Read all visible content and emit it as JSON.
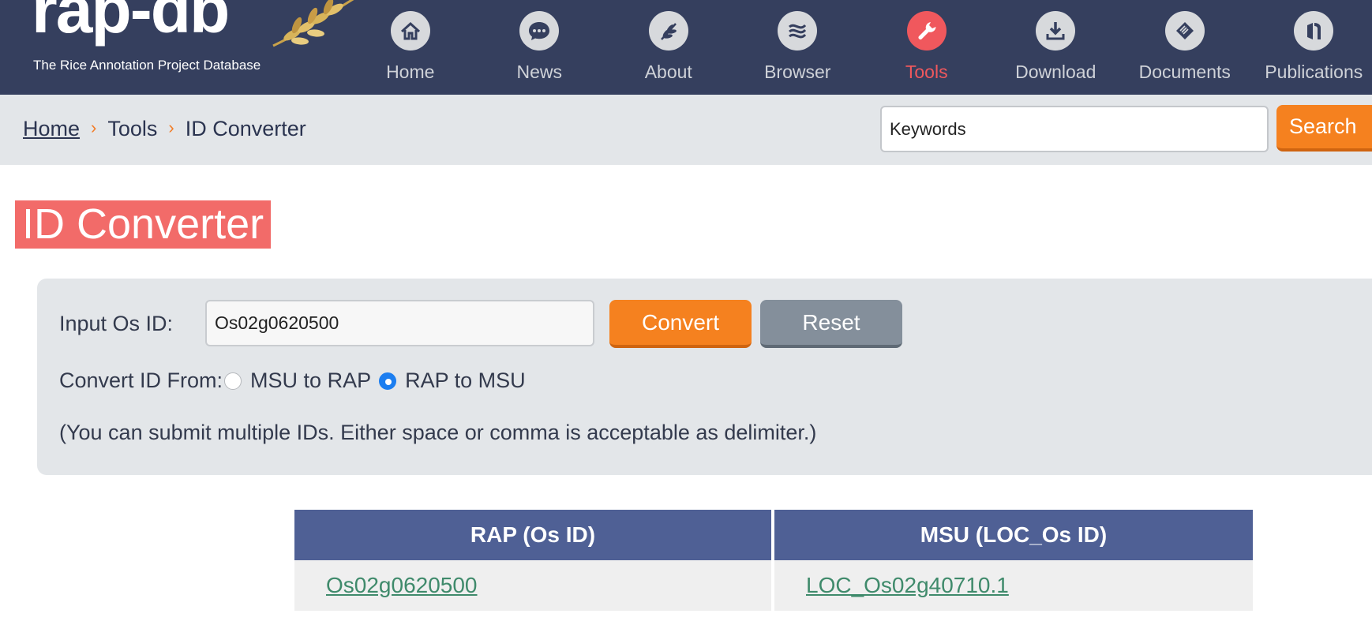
{
  "logo": {
    "word": "rap-db",
    "subtitle": "The Rice Annotation Project Database"
  },
  "nav": {
    "items": [
      {
        "label": "Home",
        "icon": "home-icon"
      },
      {
        "label": "News",
        "icon": "chat-bubble-icon"
      },
      {
        "label": "About",
        "icon": "rice-leaf-icon"
      },
      {
        "label": "Browser",
        "icon": "genome-browser-icon"
      },
      {
        "label": "Tools",
        "icon": "wrench-icon",
        "active": true
      },
      {
        "label": "Download",
        "icon": "download-icon"
      },
      {
        "label": "Documents",
        "icon": "documents-icon"
      },
      {
        "label": "Publications",
        "icon": "publications-icon"
      }
    ]
  },
  "breadcrumb": {
    "home": "Home",
    "tools": "Tools",
    "current": "ID Converter",
    "separator": "›"
  },
  "search": {
    "value": "Keywords",
    "button_label": "Search"
  },
  "page": {
    "title": "ID Converter"
  },
  "form": {
    "input_label": "Input Os ID:",
    "input_value": "Os02g0620500",
    "convert_label": "Convert",
    "reset_label": "Reset",
    "convert_from_label": "Convert ID From:",
    "options": [
      {
        "label": "MSU to RAP",
        "checked": false
      },
      {
        "label": "RAP to MSU",
        "checked": true
      }
    ],
    "note": "(You can submit multiple IDs. Either space or comma is acceptable as delimiter.)"
  },
  "results": {
    "headers": [
      "RAP (Os ID)",
      "MSU (LOC_Os ID)"
    ],
    "rows": [
      [
        "Os02g0620500",
        "LOC_Os02g40710.1"
      ]
    ]
  },
  "colors": {
    "header_bg": "#353f5e",
    "active_nav": "#f0585d",
    "accent_orange": "#f5811f",
    "title_bg": "#f26b69",
    "table_header": "#4f6095",
    "link_green": "#3f8a6b"
  }
}
